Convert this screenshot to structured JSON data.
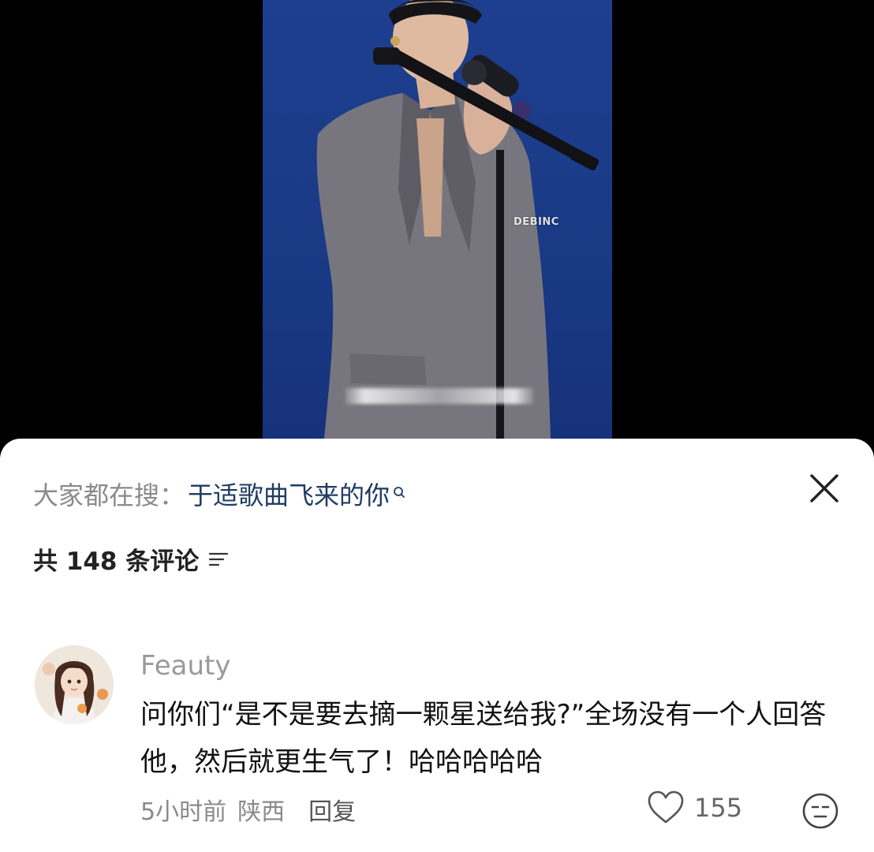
{
  "video": {
    "watermark": "DEBINC"
  },
  "sheet": {
    "search_prefix": "大家都在搜：",
    "search_term": "于适歌曲飞来的你",
    "comment_count_label": "共 148 条评论"
  },
  "comments": [
    {
      "username": "Feauty",
      "text": "问你们“是不是要去摘一颗星送给我?”全场没有一个人回答他，然后就更生气了！哈哈哈哈哈",
      "time": "5小时前",
      "location": "陕西",
      "reply_label": "回复",
      "likes": "155"
    }
  ],
  "colors": {
    "accent_link": "#1f3b63",
    "video_bg": "#1d3f8f",
    "muted_text": "#8a8a8a"
  },
  "icons": [
    "search-icon",
    "close-icon",
    "sort-icon",
    "heart-icon",
    "emoji-icon"
  ]
}
